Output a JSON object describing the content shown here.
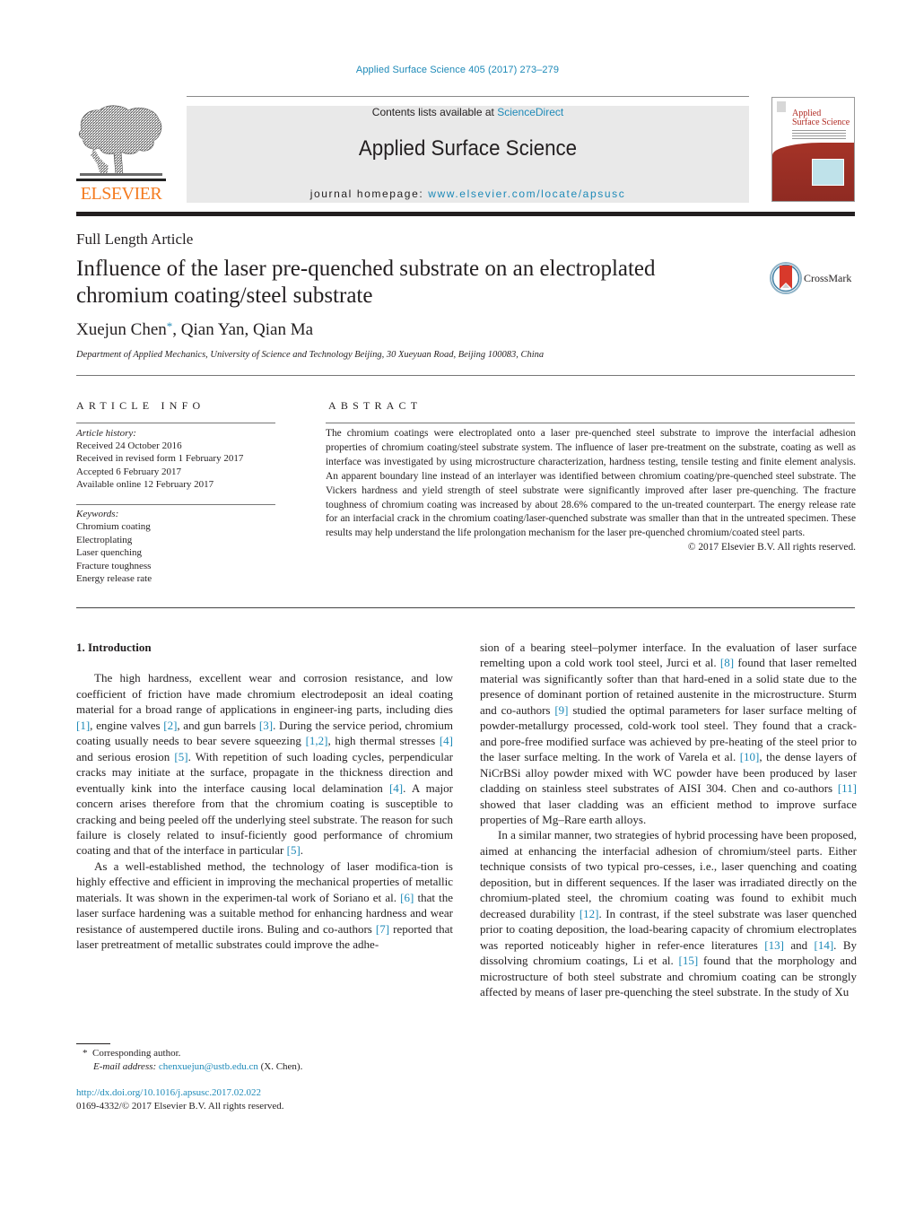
{
  "header": {
    "citation": "Applied Surface Science 405 (2017) 273–279",
    "contents_prefix": "Contents lists available at ",
    "contents_link": "ScienceDirect",
    "journal_title": "Applied Surface Science",
    "homepage_prefix": "journal homepage: ",
    "homepage_link": "www.elsevier.com/locate/apsusc",
    "publisher_logo": "ELSEVIER",
    "cover_title_line1": "Applied",
    "cover_title_line2": "Surface Science",
    "colors": {
      "link": "#1e8ab8",
      "elsevier_orange": "#f47b20",
      "cover_red": "#a53327",
      "box_gray": "#e9e9e9"
    }
  },
  "article": {
    "type": "Full Length Article",
    "title_line1": "Influence of the laser pre-quenched substrate on an electroplated",
    "title_line2": "chromium coating/steel substrate",
    "crossmark_label": "CrossMark",
    "authors": [
      {
        "name": "Xuejun Chen",
        "corresponding": "*"
      },
      {
        "name": "Qian Yan"
      },
      {
        "name": "Qian Ma"
      }
    ],
    "author_sep": ", ",
    "affiliation": "Department of Applied Mechanics, University of Science and Technology Beijing, 30 Xueyuan Road, Beijing 100083, China"
  },
  "article_info": {
    "heading": "ARTICLE INFO",
    "history_label": "Article history:",
    "history": [
      "Received 24 October 2016",
      "Received in revised form 1 February 2017",
      "Accepted 6 February 2017",
      "Available online 12 February 2017"
    ],
    "keywords_label": "Keywords:",
    "keywords": [
      "Chromium coating",
      "Electroplating",
      "Laser quenching",
      "Fracture toughness",
      "Energy release rate"
    ]
  },
  "abstract": {
    "heading": "ABSTRACT",
    "text": "The chromium coatings were electroplated onto a laser pre-quenched steel substrate to improve the interfacial adhesion properties of chromium coating/steel substrate system. The influence of laser pre-treatment on the substrate, coating as well as interface was investigated by using microstructure characterization, hardness testing, tensile testing and finite element analysis. An apparent boundary line instead of an interlayer was identified between chromium coating/pre-quenched steel substrate. The Vickers hardness and yield strength of steel substrate were significantly improved after laser pre-quenching. The fracture toughness of chromium coating was increased by about 28.6% compared to the un-treated counterpart. The energy release rate for an interfacial crack in the chromium coating/laser-quenched substrate was smaller than that in the untreated specimen. These results may help understand the life prolongation mechanism for the laser pre-quenched chromium/coated steel parts.",
    "copyright": "© 2017 Elsevier B.V. All rights reserved."
  },
  "body": {
    "section_heading": "1.  Introduction",
    "p1": [
      {
        "t": "The high hardness, excellent wear and corrosion resistance, and low coefficient of friction have made chromium electrodeposit an ideal coating material for a broad range of applications in engineer-ing parts, including dies "
      },
      {
        "r": "[1]"
      },
      {
        "t": ", engine valves "
      },
      {
        "r": "[2]"
      },
      {
        "t": ", and gun barrels "
      },
      {
        "r": "[3]"
      },
      {
        "t": ". During the service period, chromium coating usually needs to bear severe squeezing "
      },
      {
        "r": "[1,2]"
      },
      {
        "t": ", high thermal stresses "
      },
      {
        "r": "[4]"
      },
      {
        "t": " and serious erosion "
      },
      {
        "r": "[5]"
      },
      {
        "t": ". With repetition of such loading cycles, perpendicular cracks may initiate at the surface, propagate in the thickness direction and eventually kink into the interface causing local delamination "
      },
      {
        "r": "[4]"
      },
      {
        "t": ". A major concern arises therefore from that the chromium coating is susceptible to cracking and being peeled off the underlying steel substrate. The reason for such failure is closely related to insuf-ficiently good performance of chromium coating and that of the interface in particular "
      },
      {
        "r": "[5]"
      },
      {
        "t": "."
      }
    ],
    "p2": [
      {
        "t": "As a well-established method, the technology of laser modifica-tion is highly effective and efficient in improving the mechanical properties of metallic materials. It was shown in the experimen-tal work of Soriano et al. "
      },
      {
        "r": "[6]"
      },
      {
        "t": " that the laser surface hardening was a suitable method for enhancing hardness and wear resistance of austempered ductile irons. Buling and co-authors "
      },
      {
        "r": "[7]"
      },
      {
        "t": " reported that laser pretreatment of metallic substrates could improve the adhe-"
      }
    ],
    "p3": [
      {
        "t": "sion of a bearing steel–polymer interface. In the evaluation of laser surface remelting upon a cold work tool steel, Jurci et al. "
      },
      {
        "r": "[8]"
      },
      {
        "t": " found that laser remelted material was significantly softer than that hard-ened in a solid state due to the presence of dominant portion of retained austenite in the microstructure. Sturm and co-authors "
      },
      {
        "r": "[9]"
      },
      {
        "t": " studied the optimal parameters for laser surface melting of powder-metallurgy processed, cold-work tool steel. They found that a crack- and pore-free modified surface was achieved by pre-heating of the steel prior to the laser surface melting. In the work of Varela et al. "
      },
      {
        "r": "[10]"
      },
      {
        "t": ", the dense layers of NiCrBSi alloy powder mixed with WC powder have been produced by laser cladding on stainless steel substrates of AISI 304. Chen and co-authors "
      },
      {
        "r": "[11]"
      },
      {
        "t": " showed that laser cladding was an efficient method to improve surface properties of Mg–Rare earth alloys."
      }
    ],
    "p4": [
      {
        "t": "In a similar manner, two strategies of hybrid processing have been proposed, aimed at enhancing the interfacial adhesion of chromium/steel parts. Either technique consists of two typical pro-cesses, i.e., laser quenching and coating deposition, but in different sequences. If the laser was irradiated directly on the chromium-plated steel, the chromium coating was found to exhibit much decreased durability "
      },
      {
        "r": "[12]"
      },
      {
        "t": ". In contrast, if the steel substrate was laser quenched prior to coating deposition, the load-bearing capacity of chromium electroplates was reported noticeably higher in refer-ence literatures "
      },
      {
        "r": "[13]"
      },
      {
        "t": " and "
      },
      {
        "r": "[14]"
      },
      {
        "t": ". By dissolving chromium coatings, Li et al. "
      },
      {
        "r": "[15]"
      },
      {
        "t": " found that the morphology and microstructure of both steel substrate and chromium coating can be strongly affected by means of laser pre-quenching the steel substrate. In the study of Xu"
      }
    ]
  },
  "footnote": {
    "marker": "*",
    "corresponding": "Corresponding author.",
    "email_label": "E-mail address:",
    "email": "chenxuejun@ustb.edu.cn",
    "email_suffix": " (X. Chen)."
  },
  "doi": {
    "link": "http://dx.doi.org/10.1016/j.apsusc.2017.02.022",
    "issn": "0169-4332/© 2017 Elsevier B.V. All rights reserved."
  }
}
